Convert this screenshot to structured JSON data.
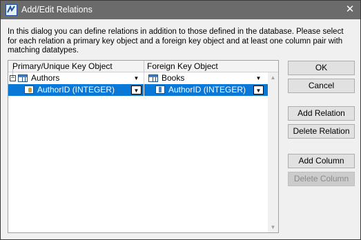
{
  "window": {
    "title": "Add/Edit Relations",
    "close_glyph": "✕"
  },
  "description": "In this dialog you can define relations in addition to those defined in the database.  Please select for each relation a primary key object and a foreign key object and at least one column pair with matching datatypes.",
  "grid": {
    "columns": [
      "Primary/Unique Key Object",
      "Foreign Key Object"
    ],
    "rows": [
      {
        "expander": "−",
        "primary": "Authors",
        "foreign": "Books",
        "primary_icon": "table-icon",
        "foreign_icon": "table-icon"
      },
      {
        "primary": "AuthorID (INTEGER)",
        "foreign": "AuthorID (INTEGER)",
        "primary_icon": "primary-key-column-icon",
        "foreign_icon": "column-icon",
        "selected": true
      }
    ],
    "dropdown_glyph": "▼"
  },
  "scrollbar": {
    "up_glyph": "▲",
    "down_glyph": "▼"
  },
  "buttons": {
    "ok": "OK",
    "cancel": "Cancel",
    "add_relation": "Add Relation",
    "delete_relation": "Delete Relation",
    "add_column": "Add Column",
    "delete_column": "Delete Column"
  },
  "colors": {
    "titlebar": "#6b6b6b",
    "selection": "#0a78d7",
    "button_face": "#e1e1e1"
  }
}
